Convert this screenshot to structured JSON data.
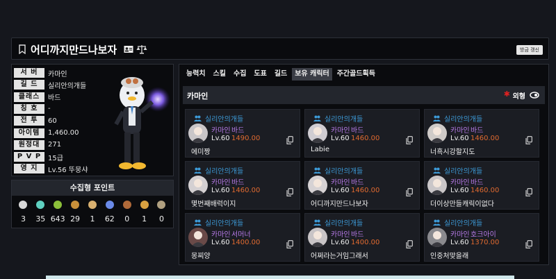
{
  "header": {
    "character_name": "어디까지만드나보자",
    "refresh_label": "방금 갱신"
  },
  "profile": {
    "rows": [
      {
        "label": "서 버",
        "value": "카마인"
      },
      {
        "label": "길 드",
        "value": "실리안의개들"
      },
      {
        "label": "클래스",
        "value": "바드"
      },
      {
        "label": "칭 호",
        "value": "-"
      },
      {
        "label": "전 투",
        "value": "60"
      },
      {
        "label": "아이템",
        "value": "1,460.00"
      },
      {
        "label": "원정대",
        "value": "271"
      },
      {
        "label": "P V P",
        "value": "15급"
      },
      {
        "label": "영 지",
        "value": "Lv.56 뚜뭉샤"
      }
    ]
  },
  "collection": {
    "title": "수집형 포인트",
    "items": [
      {
        "icon": "mokoko-seed-icon",
        "count": "3",
        "color": "#d8d8d8"
      },
      {
        "icon": "island-heart-icon",
        "count": "35",
        "color": "#5fd0c0"
      },
      {
        "icon": "giants-heart-icon",
        "count": "643",
        "color": "#8bbf3a"
      },
      {
        "icon": "great-art-icon",
        "count": "29",
        "color": "#c8903a"
      },
      {
        "icon": "ignea-token-icon",
        "count": "1",
        "color": "#d8b070"
      },
      {
        "icon": "orpheus-star-icon",
        "count": "62",
        "color": "#6a8ae8"
      },
      {
        "icon": "sea-bounty-icon",
        "count": "0",
        "color": "#b06a3a"
      },
      {
        "icon": "world-tree-leaf-icon",
        "count": "1",
        "color": "#d8a040"
      },
      {
        "icon": "omnium-star-icon",
        "count": "0",
        "color": "#b0a080"
      }
    ]
  },
  "tabs": [
    "능력치",
    "스킬",
    "수집",
    "도표",
    "길드",
    "보유 캐릭터",
    "주간골드획득"
  ],
  "active_tab": "보유 캐릭터",
  "server_bar": {
    "server": "카마인",
    "outlook_label": "외형"
  },
  "characters": [
    {
      "guild": "실리안의개들",
      "server": "카마인",
      "class": "바드",
      "level": "Lv.60",
      "item_level": "1490.00",
      "nickname": "에미짱",
      "avatar_tone": "#c9c6c8"
    },
    {
      "guild": "실리안의개들",
      "server": "카마인",
      "class": "바드",
      "level": "Lv.60",
      "item_level": "1460.00",
      "nickname": "Labie",
      "avatar_tone": "#d0cdd2"
    },
    {
      "guild": "실리안의개들",
      "server": "카마인",
      "class": "바드",
      "level": "Lv.60",
      "item_level": "1460.00",
      "nickname": "너흑시강할지도",
      "avatar_tone": "#cfcbc8"
    },
    {
      "guild": "실리안의개들",
      "server": "카마인",
      "class": "바드",
      "level": "Lv.60",
      "item_level": "1460.00",
      "nickname": "몇번째배럭이지",
      "avatar_tone": "#d4d0d2"
    },
    {
      "guild": "실리안의개들",
      "server": "카마인",
      "class": "바드",
      "level": "Lv.60",
      "item_level": "1460.00",
      "nickname": "어디까지만드나보자",
      "avatar_tone": "#d6d2d4"
    },
    {
      "guild": "실리안의개들",
      "server": "카마인",
      "class": "바드",
      "level": "Lv.60",
      "item_level": "1460.00",
      "nickname": "더이상만들캐릭이없다",
      "avatar_tone": "#cac6c8"
    },
    {
      "guild": "실리안의개들",
      "server": "카마인",
      "class": "서머너",
      "level": "Lv.60",
      "item_level": "1400.00",
      "nickname": "몽찌양",
      "avatar_tone": "#6a4a48"
    },
    {
      "guild": "실리안의개들",
      "server": "카마인",
      "class": "바드",
      "level": "Lv.60",
      "item_level": "1400.00",
      "nickname": "어쩌라는거임그래서",
      "avatar_tone": "#c8c4c6"
    },
    {
      "guild": "실리안의개들",
      "server": "카마인",
      "class": "호크아이",
      "level": "Lv.60",
      "item_level": "1370.00",
      "nickname": "인중처맞을래",
      "avatar_tone": "#8a8a8e"
    }
  ]
}
